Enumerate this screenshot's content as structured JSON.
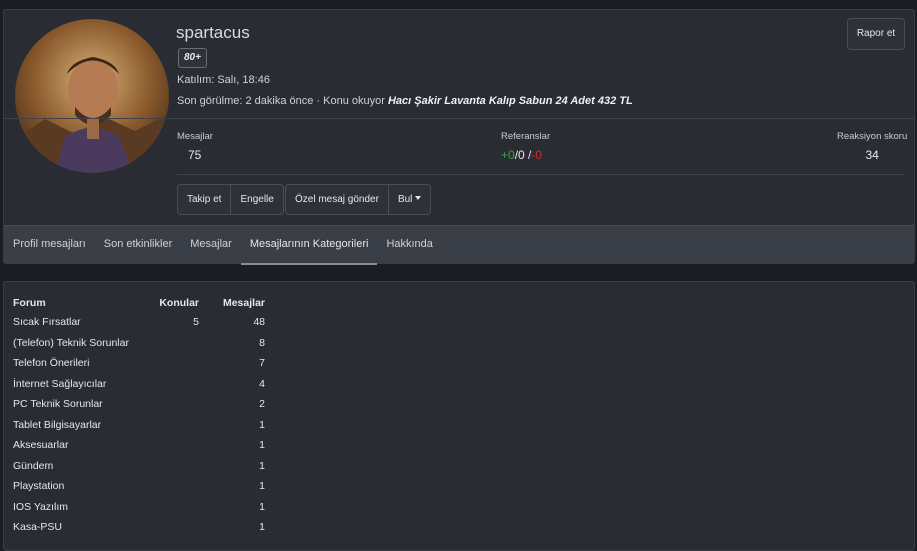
{
  "profile": {
    "username": "spartacus",
    "badge": "80+",
    "joined": "Katılım: Salı, 18:46",
    "last_seen_prefix": "Son görülme: 2 dakika önce · Konu okuyor ",
    "last_seen_topic": "Hacı Şakir Lavanta Kalıp Sabun 24 Adet 432 TL",
    "report_label": "Rapor et"
  },
  "stats": {
    "messages_label": "Mesajlar",
    "messages_value": "75",
    "references_label": "Referanslar",
    "references_positive": "+0",
    "references_neutral": "/0 /",
    "references_negative": "-0",
    "reaction_label": "Reaksiyon skoru",
    "reaction_value": "34"
  },
  "actions": {
    "follow": "Takip et",
    "block": "Engelle",
    "private_message": "Özel mesaj gönder",
    "find": "Bul"
  },
  "tabs": [
    {
      "label": "Profil mesajları"
    },
    {
      "label": "Son etkinlikler"
    },
    {
      "label": "Mesajlar"
    },
    {
      "label": "Mesajlarının Kategorileri"
    },
    {
      "label": "Hakkında"
    }
  ],
  "forum_table": {
    "headers": [
      "Forum",
      "Konular",
      "Mesajlar"
    ],
    "rows": [
      [
        "Sıcak Fırsatlar",
        "5",
        "48"
      ],
      [
        "(Telefon) Teknik Sorunlar",
        "",
        "8"
      ],
      [
        "Telefon Önerileri",
        "",
        "7"
      ],
      [
        "İnternet Sağlayıcılar",
        "",
        "4"
      ],
      [
        "PC Teknik Sorunlar",
        "",
        "2"
      ],
      [
        "Tablet Bilgisayarlar",
        "",
        "1"
      ],
      [
        "Aksesuarlar",
        "",
        "1"
      ],
      [
        "Gündem",
        "",
        "1"
      ],
      [
        "Playstation",
        "",
        "1"
      ],
      [
        "IOS Yazılım",
        "",
        "1"
      ],
      [
        "Kasa-PSU",
        "",
        "1"
      ]
    ]
  },
  "colors": {
    "positive": "#2fa63a",
    "negative": "#d02b2b",
    "background": "#1b1d22",
    "card": "#2a2c33",
    "tab_bar": "#3a3e47"
  }
}
